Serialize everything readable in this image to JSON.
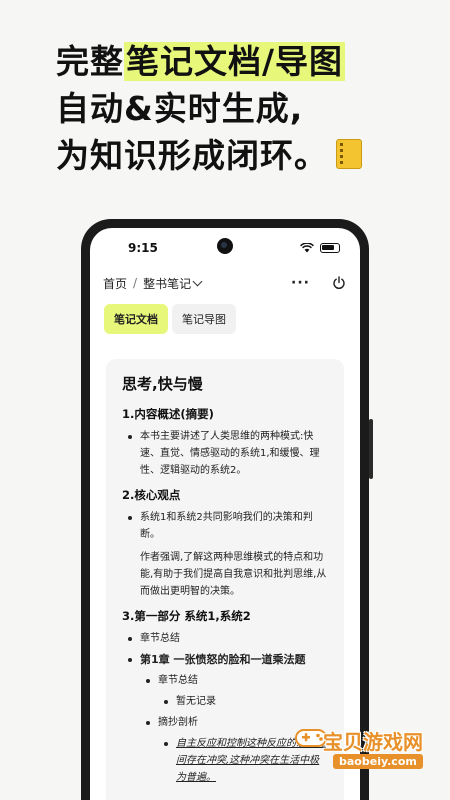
{
  "headline": {
    "line1_prefix": "完整",
    "line1_highlight": "笔记文档/导图",
    "line2": "自动&实时生成,",
    "line3": "为知识形成闭环。",
    "icon": "notebook-icon",
    "highlight_color": "#e6f77a"
  },
  "status_bar": {
    "time": "9:15"
  },
  "app_bar": {
    "breadcrumb_home": "首页",
    "breadcrumb_sep": "/",
    "breadcrumb_current": "整书笔记",
    "more": "···"
  },
  "tabs": [
    {
      "label": "笔记文档",
      "active": true
    },
    {
      "label": "笔记导图",
      "active": false
    }
  ],
  "doc": {
    "title": "思考,快与慢",
    "s1_heading": "1.内容概述(摘要)",
    "s1_item": "本书主要讲述了人类思维的两种模式:快速、直觉、情感驱动的系统1,和缓慢、理性、逻辑驱动的系统2。",
    "s2_heading": "2.核心观点",
    "s2_item": "系统1和系统2共同影响我们的决策和判断。",
    "s2_para": "作者强调,了解这两种思维模式的特点和功能,有助于我们提高自我意识和批判思维,从而做出更明智的决策。",
    "s3_heading": "3.第一部分 系统1,系统2",
    "s3_item1": "章节总结",
    "s3_item2": "第1章 一张愤怒的脸和一道乘法题",
    "s3_item3": "章节总结",
    "s3_item4": "暂无记录",
    "s3_item5": "摘抄剖析",
    "s3_item6": "自主反应和控制这种反应的意图之间存在冲突,这种冲突在生活中极为普遍。"
  },
  "watermark": {
    "text": "宝贝游戏网",
    "url": "baobeiy.com"
  }
}
